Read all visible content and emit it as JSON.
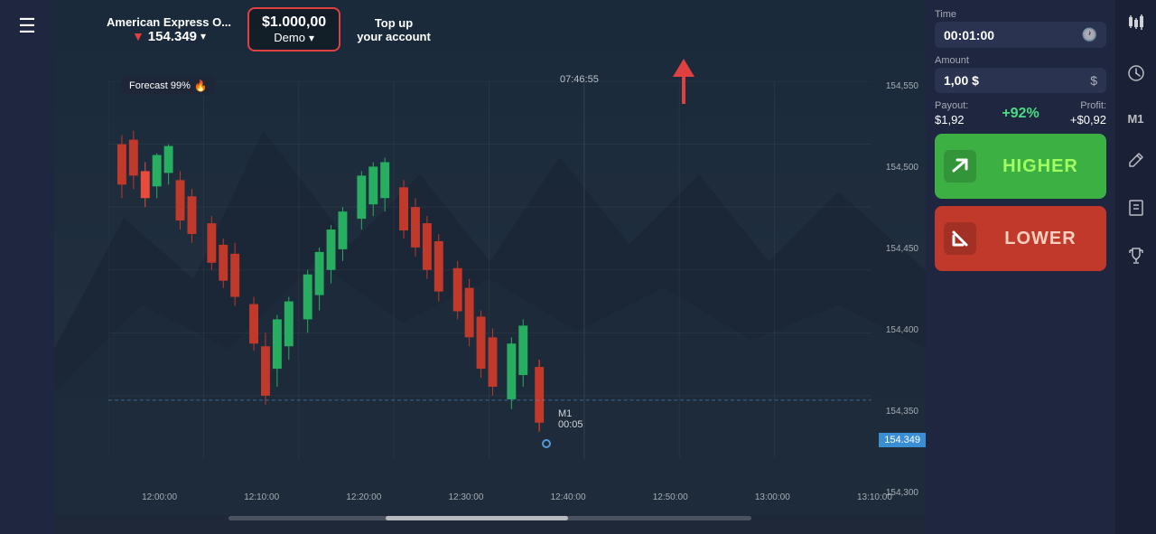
{
  "left": {
    "hamburger": "☰"
  },
  "topbar": {
    "asset_name": "American Express O...",
    "asset_price": "154.349",
    "balance_amount": "$1.000,00",
    "balance_demo": "Demo",
    "top_up_line1": "Top up",
    "top_up_line2": "your account"
  },
  "chart": {
    "time_label": "07:46:55",
    "forecast": "Forecast 99%",
    "m1_label": "M1",
    "m1_time": "00:05",
    "current_price": "154.349",
    "xaxis": [
      "12:00:00",
      "12:10:00",
      "12:20:00",
      "12:30:00",
      "12:40:00",
      "12:50:00",
      "13:00:00",
      "13:10:00"
    ],
    "yaxis": [
      "154,550",
      "154,500",
      "154,450",
      "154,400",
      "154,350",
      "154,300"
    ]
  },
  "right_panel": {
    "time_label": "Time",
    "time_value": "00:01:00",
    "amount_label": "Amount",
    "amount_value": "1,00 $",
    "currency_symbol": "$",
    "payout_label": "Payout:",
    "payout_value": "$1,92",
    "payout_percent": "+92%",
    "profit_label": "Profit:",
    "profit_value": "+$0,92",
    "m1_label": "M1",
    "btn_higher": "HIGHER",
    "btn_lower": "LOWER"
  },
  "far_right": {
    "chart_icon": "📊",
    "clock_icon": "🕐",
    "edit_icon": "✏️",
    "book_icon": "📖",
    "trophy_icon": "🏆"
  }
}
